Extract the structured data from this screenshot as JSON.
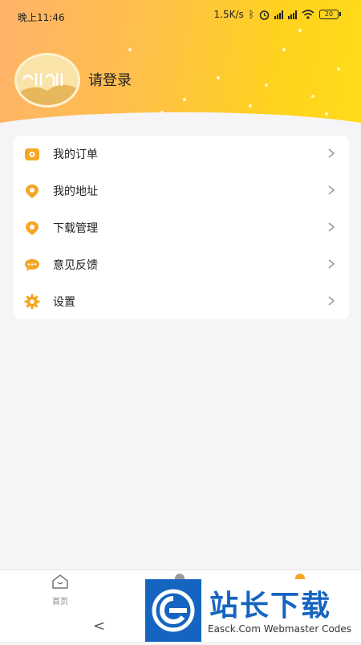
{
  "status_bar": {
    "time": "晚上11:46",
    "speed": "1.5K/s",
    "battery": "20"
  },
  "profile": {
    "login_label": "请登录"
  },
  "menu": {
    "items": [
      {
        "label": "我的订单",
        "icon": "order-icon"
      },
      {
        "label": "我的地址",
        "icon": "location-icon"
      },
      {
        "label": "下载管理",
        "icon": "download-icon"
      },
      {
        "label": "意见反馈",
        "icon": "feedback-icon"
      },
      {
        "label": "设置",
        "icon": "gear-icon"
      }
    ]
  },
  "tabbar": {
    "home_label": "首页"
  },
  "watermark": {
    "title": "站长下载",
    "subtitle": "Easck.Com Webmaster Codes"
  },
  "colors": {
    "accent": "#f5a623",
    "header_start": "#ffb36a",
    "header_end": "#ffdc1a",
    "watermark_blue": "#1565c0"
  }
}
